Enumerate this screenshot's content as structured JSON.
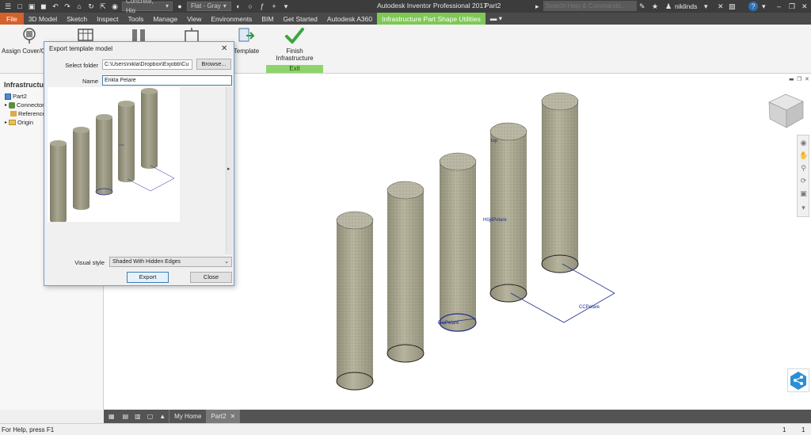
{
  "titlebar": {
    "app_title": "Autodesk Inventor Professional 2017",
    "doc_title": "Part2",
    "material": "Concrete, Hig",
    "appearance": "Flat - Gray",
    "search_placeholder": "Search Help & Commands...",
    "user": "niklinds",
    "help": "?"
  },
  "tabs": [
    {
      "label": "File"
    },
    {
      "label": "3D Model"
    },
    {
      "label": "Sketch"
    },
    {
      "label": "Inspect"
    },
    {
      "label": "Tools"
    },
    {
      "label": "Manage"
    },
    {
      "label": "View"
    },
    {
      "label": "Environments"
    },
    {
      "label": "BIM"
    },
    {
      "label": "Get Started"
    },
    {
      "label": "Autodesk A360"
    },
    {
      "label": "Infrastructure Part Shape Utilities"
    }
  ],
  "ribbon": {
    "assign_cover": "Assign Cover/G",
    "template": "Template",
    "finish_line1": "Finish",
    "finish_line2": "Infrastructure",
    "exit_panel": "Exit"
  },
  "browser": {
    "title": "Infrastructure",
    "items": [
      {
        "label": "Part2"
      },
      {
        "label": "Connectors"
      },
      {
        "label": "Reference"
      },
      {
        "label": "Origin"
      }
    ]
  },
  "dialog": {
    "title": "Export template model",
    "select_folder_label": "Select folder",
    "folder_value": "C:\\Users\\nikla\\Dropbox\\Exjobb\\Cu",
    "browse_label": "Browse...",
    "name_label": "Name",
    "name_value": "Enkla Pelare",
    "visual_style_label": "Visual style",
    "visual_style_value": "Shaded With Hidden Edges",
    "export_label": "Export",
    "close_label": "Close"
  },
  "viewport": {
    "annotations": {
      "top": "top",
      "hojd": "HöjdPelare",
      "cc": "CCPelare",
      "dia": "DiaPelare"
    }
  },
  "doctabs": {
    "my_home": "My Home",
    "part2": "Part2"
  },
  "status": {
    "help_text": "For Help, press F1",
    "count1": "1",
    "count2": "1"
  },
  "colors": {
    "file_tab": "#d5612c",
    "active_tab": "#7ec855",
    "column_fill": "#a7a58d",
    "dimension": "#1f2b8f"
  }
}
